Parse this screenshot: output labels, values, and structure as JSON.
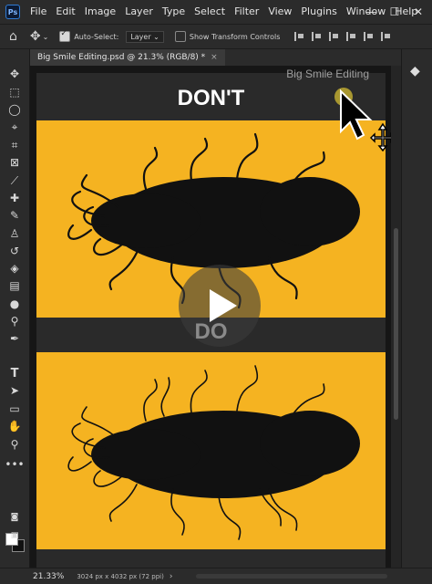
{
  "app": {
    "logo": "Ps"
  },
  "menu": [
    "File",
    "Edit",
    "Image",
    "Layer",
    "Type",
    "Select",
    "Filter",
    "View",
    "Plugins",
    "Window",
    "Help"
  ],
  "window_controls": {
    "minimize": "—",
    "maximize": "☐",
    "close": "✕"
  },
  "options_bar": {
    "auto_select_label": "Auto-Select:",
    "auto_select_checked": true,
    "auto_select_target": "Layer",
    "show_transform_label": "Show Transform Controls",
    "show_transform_checked": false
  },
  "tools": [
    "move-tool",
    "marquee-tool",
    "lasso-tool",
    "object-select-tool",
    "crop-tool",
    "frame-tool",
    "eyedropper-tool",
    "healing-brush-tool",
    "brush-tool",
    "clone-stamp-tool",
    "history-brush-tool",
    "eraser-tool",
    "gradient-tool",
    "blur-tool",
    "dodge-tool",
    "pen-tool",
    "type-tool",
    "path-select-tool",
    "rectangle-tool",
    "hand-tool",
    "zoom-tool",
    "more-tools"
  ],
  "tab": {
    "title": "Big Smile Editing.psd @ 21.3% (RGB/8) *",
    "close": "×"
  },
  "canvas": {
    "watermark": "Big Smile Editing",
    "top_label": "DON'T",
    "bottom_label": "DO",
    "colors": {
      "background": "#2a2a2a",
      "panel": "#f5b321",
      "hair": "#111111"
    }
  },
  "status": {
    "zoom": "21.33%",
    "doc_info": "3024 px x 4032 px (72 ppi)",
    "chevron": "›"
  }
}
